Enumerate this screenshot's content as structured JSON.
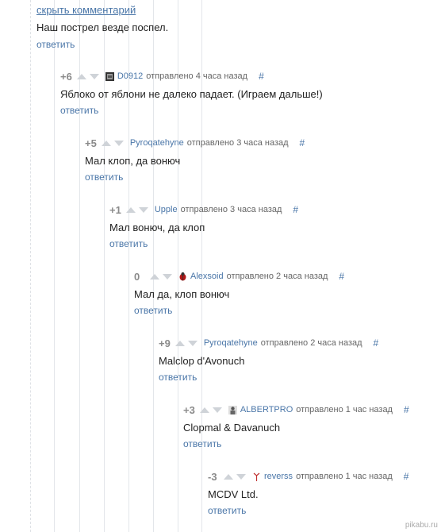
{
  "top": {
    "hide_link": "скрыть комментарий",
    "text": "Наш пострел везде поспел.",
    "reply": "ответить"
  },
  "comments": [
    {
      "rating": "+6",
      "author": "D0912",
      "sent": "отправлено 4 часа назад",
      "hash": "#",
      "text": "Яблоко от яблони не далеко падает. (Играем дальше!)",
      "reply": "ответить",
      "avatar_icon": "avatar-image-icon"
    },
    {
      "rating": "+5",
      "author": "Pyroqatehyne",
      "sent": "отправлено 3 часа назад",
      "hash": "#",
      "text": "Мал клоп, да вонюч",
      "reply": "ответить"
    },
    {
      "rating": "+1",
      "author": "Upple",
      "sent": "отправлено 3 часа назад",
      "hash": "#",
      "text": "Мал вонюч, да клоп",
      "reply": "ответить"
    },
    {
      "rating": "0",
      "author": "Alexsoid",
      "sent": "отправлено 2 часа назад",
      "hash": "#",
      "text": "Мал да, клоп вонюч",
      "reply": "ответить",
      "avatar_icon": "red-bug-icon"
    },
    {
      "rating": "+9",
      "author": "Pyroqatehyne",
      "sent": "отправлено 2 часа назад",
      "hash": "#",
      "text": "Malclop d'Avonuch",
      "reply": "ответить"
    },
    {
      "rating": "+3",
      "author": "ALBERTPRO",
      "sent": "отправлено 1 час назад",
      "hash": "#",
      "text": "Clopmal & Davanuch",
      "reply": "ответить",
      "avatar_icon": "gray-figure-icon"
    },
    {
      "rating": "-3",
      "author": "reverss",
      "sent": "отправлено 1 час назад",
      "hash": "#",
      "text": "MCDV Ltd.",
      "reply": "ответить",
      "avatar_icon": "red-tool-icon"
    }
  ],
  "watermark": "pikabu.ru",
  "colors": {
    "link": "#4a76a8",
    "rating": "#8a8a8a",
    "arrow": "#cfd3d8"
  }
}
